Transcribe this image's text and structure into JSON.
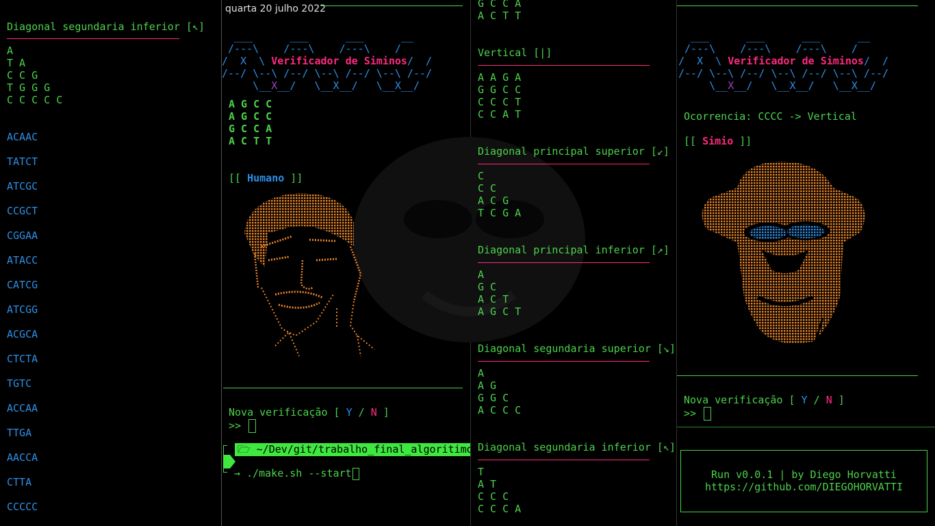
{
  "colors": {
    "green": "#4cd34c",
    "blue": "#2f8fe6",
    "pink": "#ff2a80",
    "orange": "#e8832a"
  },
  "pane1": {
    "title": "Diagonal segundaria inferior [↖]",
    "triangle": [
      "A",
      "T A",
      "C C G",
      "T G G G",
      "C C C C C"
    ],
    "sequences": [
      "ACAAC",
      "TATCT",
      "ATCGC",
      "CCGCT",
      "CGGAA",
      "ATACC",
      "CATCG",
      "ATCGG",
      "ACGCA",
      "CTCTA",
      "TGTC",
      "ACCAA",
      "TTGA",
      "AACCA",
      "CTTA",
      "CCCCC"
    ]
  },
  "clock": {
    "date": "quarta 20 julho 2022"
  },
  "banner": {
    "line1": "  ___      ___      ___      __",
    "line2": " /---\\    /---\\    /---\\    /",
    "line3a": "/  X  \\ ",
    "title": "Verificador de Siminos",
    "line3b": "/  /",
    "line4": "/--/ \\--\\ /--/ \\--\\ /--/ \\--\\ /--/",
    "line5a": "     \\__",
    "x1": "X",
    "line5b": "__/   \\__X__/   \\__X__/"
  },
  "pane2": {
    "matrix": [
      "A G C C",
      "A G C C",
      "G C C A",
      "A C T T"
    ],
    "result_open": "[[ ",
    "result_label": "Humano",
    "result_close": " ]]",
    "prompt_question": "Nova verificação [ ",
    "prompt_y": "Y",
    "prompt_sep": " / ",
    "prompt_n": "N",
    "prompt_end": " ]",
    "prompt_marker": ">>",
    "shell_path": "~/Dev/git/trabalho_final_algoritimo",
    "shell_arrow": "→",
    "shell_command": "./make.sh --start"
  },
  "pane3": {
    "top_rows": [
      "G C C A",
      "A C T T"
    ],
    "sections": [
      {
        "title": "Vertical [|]",
        "rows": [
          "A A G A",
          "G G C C",
          "C C C T",
          "C C A T"
        ]
      },
      {
        "title": "Diagonal principal superior [↙]",
        "rows": [
          "C",
          "C C",
          "A C G",
          "T C G A"
        ]
      },
      {
        "title": "Diagonal principal inferior [↗]",
        "rows": [
          "A",
          "G C",
          "A C T",
          "A G C T"
        ]
      },
      {
        "title": "Diagonal segundaria superior [↘]",
        "rows": [
          "A",
          "A G",
          "G G C",
          "A C C C"
        ]
      },
      {
        "title": "Diagonal segundaria inferior [↖]",
        "rows": [
          "T",
          "A T",
          "C C C",
          "C C C A"
        ]
      }
    ]
  },
  "pane4": {
    "occurrence": "Ocorrencia: CCCC -> Vertical",
    "result_open": "[[ ",
    "result_label": "Simio",
    "result_close": " ]]",
    "prompt_question": "Nova verificação [ ",
    "prompt_y": "Y",
    "prompt_sep": " / ",
    "prompt_n": "N",
    "prompt_end": " ]",
    "prompt_marker": ">>",
    "footer_line1": "Run v0.0.1 | by Diego Horvatti",
    "footer_line2": "https://github.com/DIEGOHORVATTI"
  }
}
